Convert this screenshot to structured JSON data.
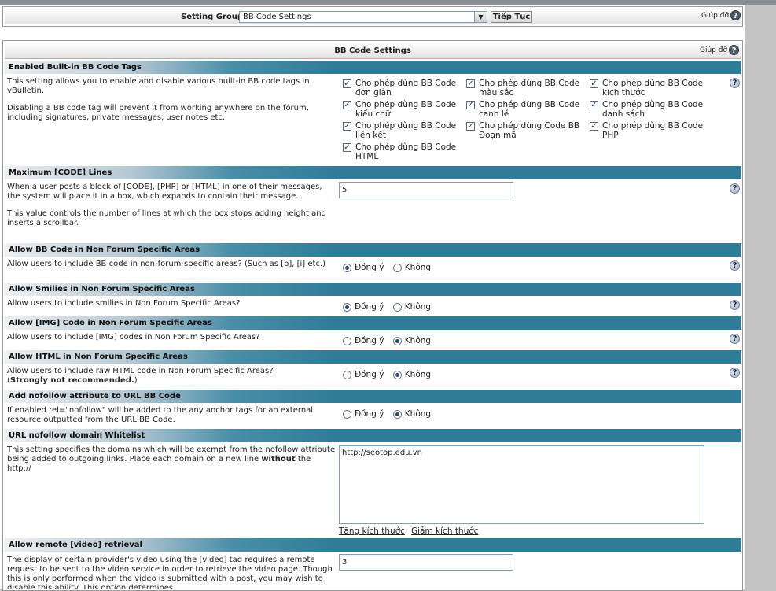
{
  "setting_group": {
    "label": "Setting Group",
    "selected": "BB Code Settings",
    "go_button": "Tiếp Tục",
    "help_label": "Giúp đỡ"
  },
  "panel": {
    "title": "BB Code Settings",
    "help_label": "Giúp đỡ"
  },
  "help_icon": "?",
  "sections": {
    "builtin_tags": {
      "title": "Enabled Built-in BB Code Tags",
      "desc1": "This setting allows you to enable and disable various built-in BB code tags in vBulletin.",
      "desc2": "Disabling a BB code tag will prevent it from working anywhere on the forum, including signatures, private messages, user notes etc.",
      "options": [
        {
          "label": "Cho phép dùng BB Code đơn giản",
          "checked": true
        },
        {
          "label": "Cho phép dùng BB Code màu sắc",
          "checked": true
        },
        {
          "label": "Cho phép dùng BB Code kích thước",
          "checked": true
        },
        {
          "label": "Cho phép dùng BB Code kiểu chữ",
          "checked": true
        },
        {
          "label": "Cho phép dùng BB Code canh lề",
          "checked": true
        },
        {
          "label": "Cho phép dùng BB Code danh sách",
          "checked": true
        },
        {
          "label": "Cho phép dùng BB Code liên kết",
          "checked": true
        },
        {
          "label": "Cho phép dùng Code BB Đoạn mã",
          "checked": true
        },
        {
          "label": "Cho phép dùng BB Code PHP",
          "checked": true
        },
        {
          "label": "Cho phép dùng BB Code HTML",
          "checked": true
        }
      ]
    },
    "code_lines": {
      "title": "Maximum [CODE] Lines",
      "desc1": "When a user posts a block of [CODE], [PHP] or [HTML] in one of their messages, the system will place it in a box, which expands to contain their message.",
      "desc2": "This value controls the number of lines at which the box stops adding height and inserts a scrollbar.",
      "value": "5"
    },
    "non_forum": {
      "title": "Allow BB Code in Non Forum Specific Areas",
      "desc": "Allow users to include BB code in non-forum-specific areas? (Such as [b], [i] etc.)"
    },
    "smilies": {
      "title": "Allow Smilies in Non Forum Specific Areas",
      "desc": "Allow users to include smilies in Non Forum Specific Areas?"
    },
    "img": {
      "title": "Allow [IMG] Code in Non Forum Specific Areas",
      "desc": "Allow users to include [IMG] codes in Non Forum Specific Areas?"
    },
    "html": {
      "title": "Allow HTML in Non Forum Specific Areas",
      "desc": "Allow users to include raw HTML code in Non Forum Specific Areas?",
      "desc_open": "(",
      "desc_strong": "Strongly not recommended.",
      "desc_close": ")"
    },
    "nofollow": {
      "title": "Add nofollow attribute to URL BB Code",
      "desc": "If enabled rel=\"nofollow\" will be added to the any anchor tags for an external resource outputted from the URL BB Code."
    },
    "whitelist": {
      "title": "URL nofollow domain Whitelist",
      "desc_pre": "This setting specifies the domains which will be exempt from the nofollow attribute being added to outgoing links. Place each domain on a new line ",
      "desc_bold": "without",
      "desc_post": " the http://",
      "value": "http://seotop.edu.vn",
      "enlarge": "Tăng kích thước",
      "shrink": "Giảm kích thước"
    },
    "video": {
      "title": "Allow remote [video] retrieval",
      "desc": "The display of certain provider's video using the [video] tag requires a remote request to be sent to the video service in order to retrieve the video page. Though this is only performed when the video is submitted with a post, you may wish to disable this ability. This option determines",
      "value": "3"
    }
  },
  "radio_labels": {
    "yes": "Đồng ý",
    "no": "Không"
  },
  "radio_values": {
    "non_forum": "yes",
    "smilies": "yes",
    "img": "no",
    "html": "no",
    "nofollow": "no"
  }
}
